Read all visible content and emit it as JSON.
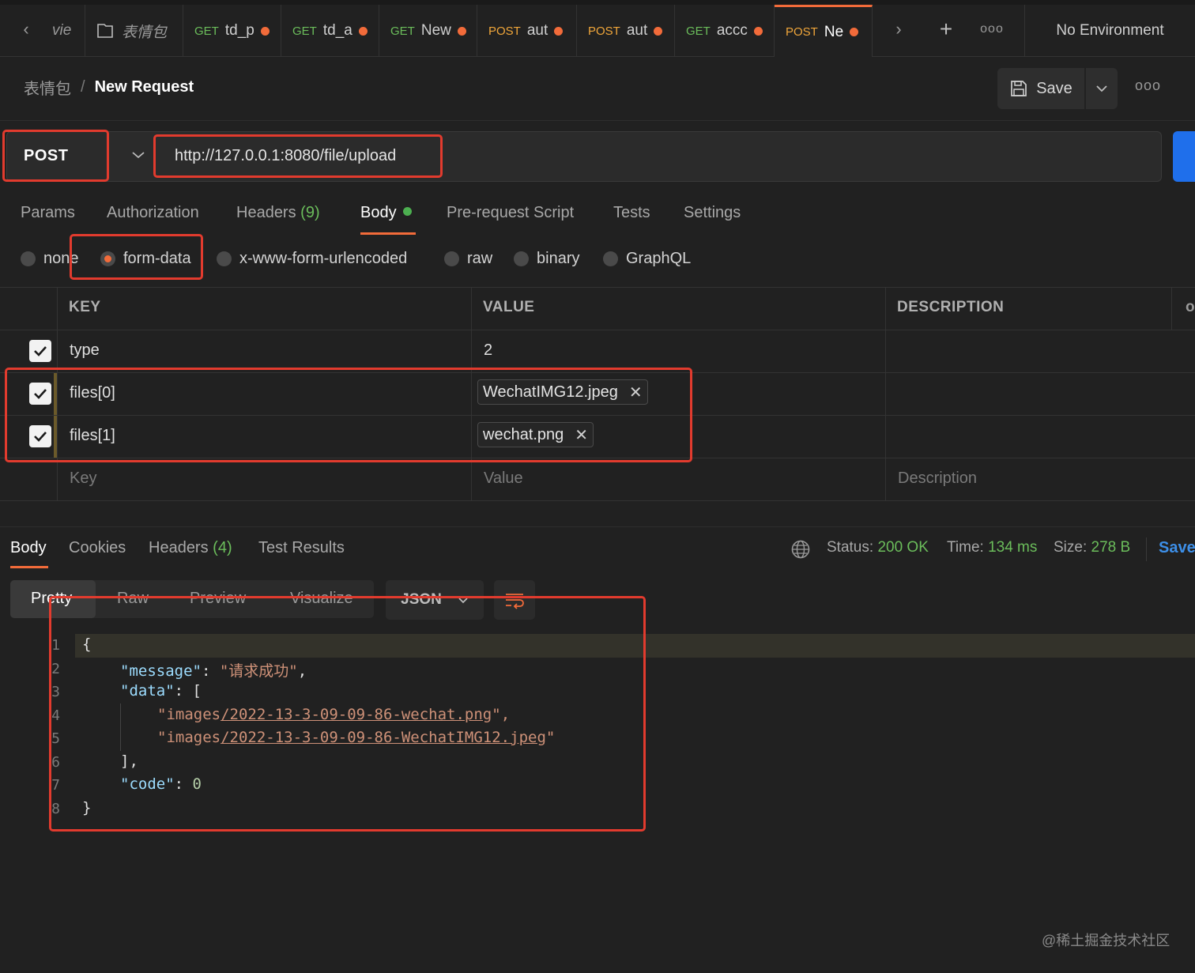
{
  "tabs": [
    {
      "method": "",
      "name": "vie",
      "dirty": false
    },
    {
      "method": "",
      "name": "表情包",
      "dirty": false,
      "icon": "collection-icon"
    },
    {
      "method": "GET",
      "name": "td_p",
      "dirty": true
    },
    {
      "method": "GET",
      "name": "td_a",
      "dirty": true
    },
    {
      "method": "GET",
      "name": "New",
      "dirty": true
    },
    {
      "method": "POST",
      "name": "aut",
      "dirty": true
    },
    {
      "method": "POST",
      "name": "aut",
      "dirty": true
    },
    {
      "method": "GET",
      "name": "accc",
      "dirty": true
    },
    {
      "method": "POST",
      "name": "Ne",
      "dirty": true,
      "active": true
    }
  ],
  "environment": "No Environment",
  "breadcrumb": {
    "parent": "表情包",
    "separator": "/",
    "current": "New Request"
  },
  "toolbar": {
    "save_label": "Save"
  },
  "request": {
    "method": "POST",
    "url": "http://127.0.0.1:8080/file/upload"
  },
  "request_tabs": {
    "params": "Params",
    "authorization": "Authorization",
    "headers": "Headers",
    "headers_count": "(9)",
    "body": "Body",
    "pre_request": "Pre-request Script",
    "tests": "Tests",
    "settings": "Settings"
  },
  "body_types": {
    "none": "none",
    "form_data": "form-data",
    "urlencoded": "x-www-form-urlencoded",
    "raw": "raw",
    "binary": "binary",
    "graphql": "GraphQL",
    "selected": "form-data"
  },
  "table": {
    "headers": {
      "key": "KEY",
      "value": "VALUE",
      "description": "DESCRIPTION"
    },
    "rows": [
      {
        "key": "type",
        "value": "2",
        "checked": true
      },
      {
        "key": "files[0]",
        "value": "WechatIMG12.jpeg",
        "checked": true
      },
      {
        "key": "files[1]",
        "value": "wechat.png",
        "checked": true
      }
    ],
    "placeholders": {
      "key": "Key",
      "value": "Value",
      "description": "Description"
    }
  },
  "response": {
    "tabs": {
      "body": "Body",
      "cookies": "Cookies",
      "headers": "Headers",
      "headers_count": "(4)",
      "test_results": "Test Results"
    },
    "status_label": "Status:",
    "status_value": "200 OK",
    "time_label": "Time:",
    "time_value": "134 ms",
    "size_label": "Size:",
    "size_value": "278 B",
    "save_label": "Save",
    "views": {
      "pretty": "Pretty",
      "raw": "Raw",
      "preview": "Preview",
      "visualize": "Visualize"
    },
    "format": "JSON",
    "code_lines": {
      "l1": "{",
      "l2_key": "\"message\"",
      "l2_val": "\"请求成功\"",
      "l3_key": "\"data\"",
      "l4_pre": "\"images",
      "l4_link": "/2022-13-3-09-09-86-wechat.png",
      "l4_post": "\",",
      "l5_pre": "\"images",
      "l5_link": "/2022-13-3-09-09-86-WechatIMG12.jpeg",
      "l5_post": "\"",
      "l6": "],",
      "l7_key": "\"code\"",
      "l7_val": "0",
      "l8": "}"
    },
    "line_numbers": [
      "1",
      "2",
      "3",
      "4",
      "5",
      "6",
      "7",
      "8"
    ]
  },
  "watermark": "@稀土掘金技术社区",
  "colors": {
    "accent": "#f26b3a",
    "get": "#6bbd5b",
    "post": "#f0a63a",
    "annotation": "#e23b2e",
    "send": "#1f6feb"
  }
}
